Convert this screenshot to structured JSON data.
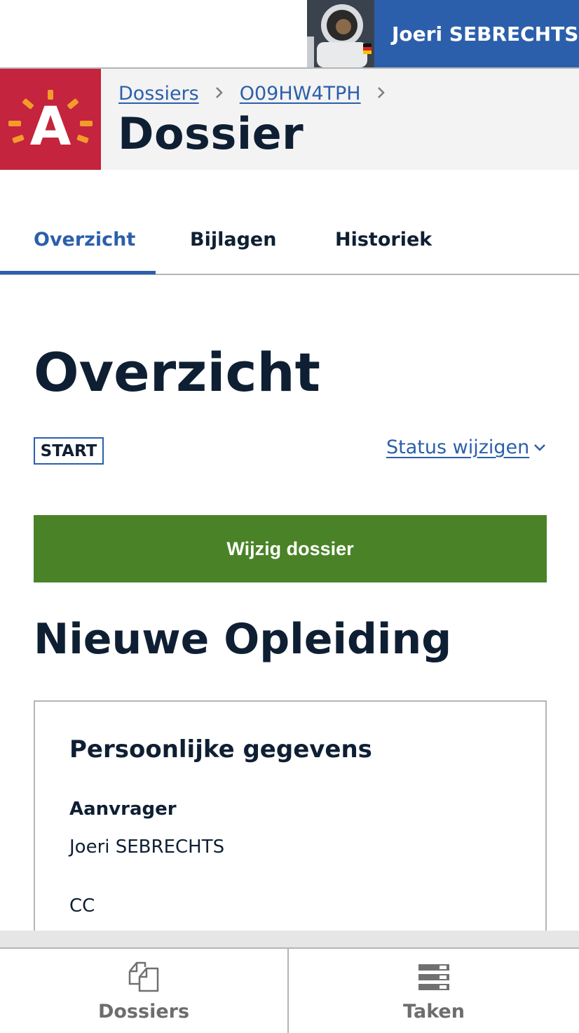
{
  "user": {
    "name": "Joeri SEBRECHTS"
  },
  "breadcrumb": [
    "Dossiers",
    "O09HW4TPH"
  ],
  "header": {
    "title": "Dossier",
    "logo_letter": "A"
  },
  "tabs": [
    "Overzicht",
    "Bijlagen",
    "Historiek"
  ],
  "overview": {
    "heading": "Overzicht",
    "status_badge": "START",
    "status_link": "Status wijzigen",
    "primary_button": "Wijzig dossier"
  },
  "form": {
    "title": "Nieuwe Opleiding",
    "section_title": "Persoonlijke gegevens",
    "applicant_label": "Aanvrager",
    "applicant_value": "Joeri SEBRECHTS",
    "cc_label": "CC"
  },
  "bottom_nav": [
    {
      "label": "Dossiers",
      "icon": "documents-icon"
    },
    {
      "label": "Taken",
      "icon": "tasks-icon"
    }
  ],
  "colors": {
    "brand_red": "#c4243d",
    "accent_blue": "#2c5fab",
    "primary_green": "#4a8327",
    "logo_rays": "#f39c2a"
  }
}
